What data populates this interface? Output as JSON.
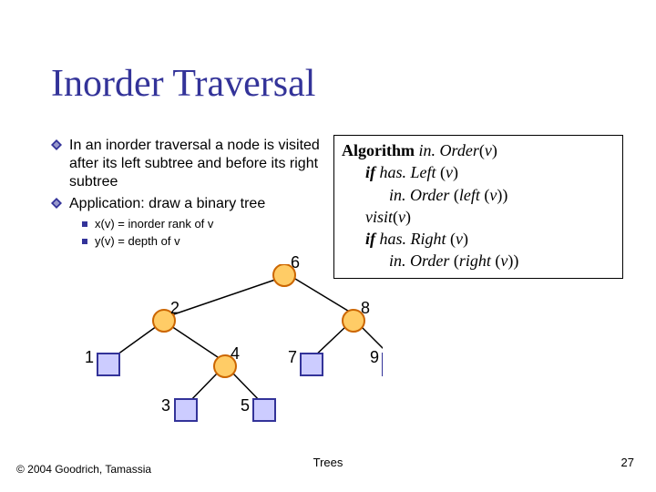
{
  "title": "Inorder Traversal",
  "bullets": {
    "b1": "In an inorder traversal a node is visited after its left subtree and before its right subtree",
    "b2": "Application: draw a binary tree",
    "s1": "x(v) = inorder rank of v",
    "s2": "y(v) = depth of v"
  },
  "algo": {
    "kw_algo": "Algorithm",
    "fn_algo": "in. Order",
    "arg_v": "v",
    "kw_if1": "if",
    "fn_hasLeft": "has. Left",
    "fn_inOrder": "in. Order",
    "fn_left": "left",
    "fn_visit": "visit",
    "kw_if2": "if",
    "fn_hasRight": "has. Right",
    "fn_right": "right"
  },
  "tree_labels": {
    "n6": "6",
    "n2": "2",
    "n8": "8",
    "n1": "1",
    "n4": "4",
    "n7": "7",
    "n9": "9",
    "n3": "3",
    "n5": "5"
  },
  "footer": {
    "copyright": "© 2004 Goodrich, Tamassia",
    "center": "Trees",
    "page": "27"
  },
  "colors": {
    "title": "#333399",
    "circle_fill": "#ffcc66",
    "circle_stroke": "#cc6600",
    "box_fill": "#ccccff",
    "box_stroke": "#333399",
    "line": "#000"
  }
}
